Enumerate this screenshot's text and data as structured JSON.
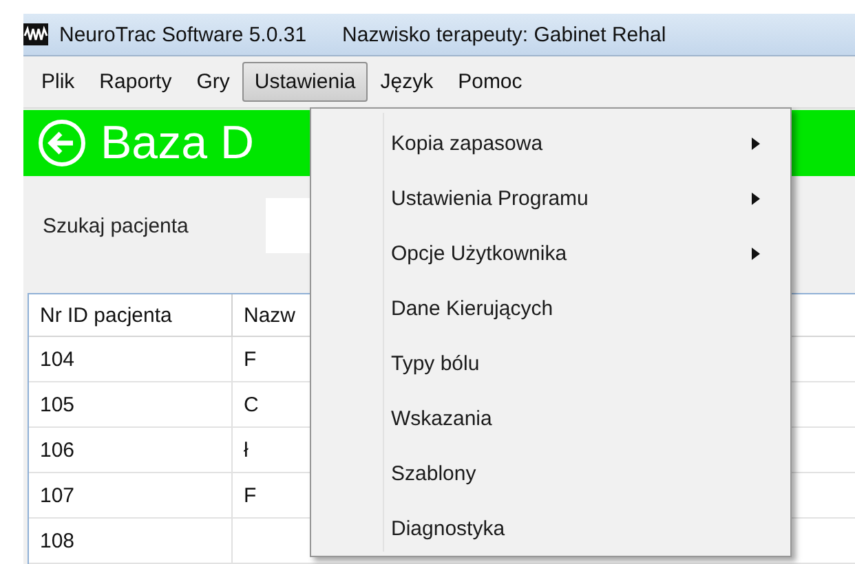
{
  "window": {
    "title": "NeuroTrac Software 5.0.31",
    "subtitle": "Nazwisko terapeuty: Gabinet Rehal"
  },
  "menu_bar": [
    {
      "label": "Plik",
      "selected": false
    },
    {
      "label": "Raporty",
      "selected": false
    },
    {
      "label": "Gry",
      "selected": false
    },
    {
      "label": "Ustawienia",
      "selected": true
    },
    {
      "label": "Język",
      "selected": false
    },
    {
      "label": "Pomoc",
      "selected": false
    }
  ],
  "header": {
    "title": "Baza D"
  },
  "search": {
    "label": "Szukaj pacjenta"
  },
  "table": {
    "columns": [
      "Nr ID pacjenta",
      "Nazw"
    ],
    "rows": [
      [
        "104",
        "F"
      ],
      [
        "105",
        "C"
      ],
      [
        "106",
        "ł"
      ],
      [
        "107",
        "F"
      ],
      [
        "108"
      ]
    ]
  },
  "dropdown": {
    "items": [
      {
        "label": "Kopia zapasowa",
        "submenu": true
      },
      {
        "label": "Ustawienia Programu",
        "submenu": true
      },
      {
        "label": "Opcje Użytkownika",
        "submenu": true
      },
      {
        "label": "Dane Kierujących",
        "submenu": false
      },
      {
        "label": "Typy bólu",
        "submenu": false
      },
      {
        "label": "Wskazania",
        "submenu": false
      },
      {
        "label": "Szablony",
        "submenu": false
      },
      {
        "label": "Diagnostyka",
        "submenu": false
      }
    ]
  }
}
